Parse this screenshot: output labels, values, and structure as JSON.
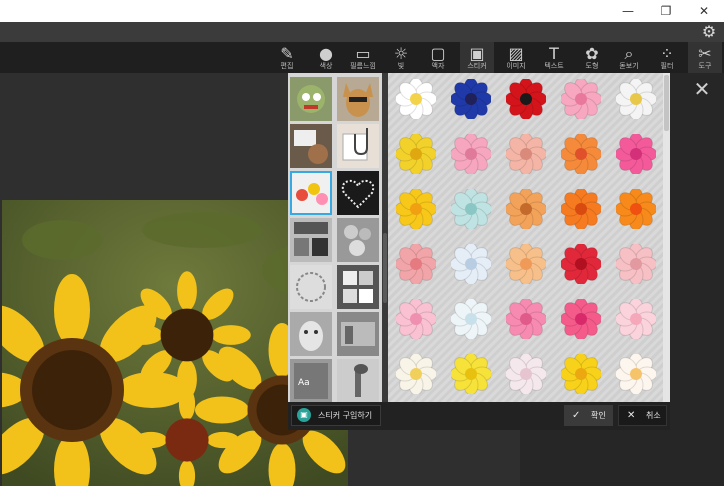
{
  "window": {
    "minimize_glyph": "—",
    "restore_glyph": "❐",
    "close_glyph": "✕"
  },
  "settings_icon": "gear-icon",
  "toolbar": {
    "items": [
      {
        "label": "편집",
        "icon": "edit-icon",
        "glyph": "✎"
      },
      {
        "label": "색상",
        "icon": "circle-icon",
        "glyph": "●"
      },
      {
        "label": "필름느낌",
        "icon": "film-icon",
        "glyph": "▭"
      },
      {
        "label": "빛",
        "icon": "sun-icon",
        "glyph": "☼"
      },
      {
        "label": "액자",
        "icon": "frame-icon",
        "glyph": "▢"
      },
      {
        "label": "스티커",
        "icon": "sticker-icon",
        "glyph": "▣"
      },
      {
        "label": "이미지",
        "icon": "image-icon",
        "glyph": "▨"
      },
      {
        "label": "텍스트",
        "icon": "text-icon",
        "glyph": "T"
      },
      {
        "label": "도형",
        "icon": "shape-icon",
        "glyph": "✿"
      },
      {
        "label": "돋보기",
        "icon": "magnifier-icon",
        "glyph": "⌕"
      },
      {
        "label": "필터",
        "icon": "filter-icon",
        "glyph": "⁘"
      },
      {
        "label": "도구",
        "icon": "tools-icon",
        "glyph": "✂"
      }
    ]
  },
  "close_panel_glyph": "✕",
  "sticker_panel": {
    "categories_selected_index": 4,
    "buy_label": "스티커 구입하기",
    "ok_label": "확인",
    "cancel_label": "취소",
    "ok_glyph": "✓",
    "cancel_glyph": "✕"
  },
  "colors": {
    "accent_selection": "#38a8e0",
    "buy_icon_bg": "#2aa39a"
  }
}
